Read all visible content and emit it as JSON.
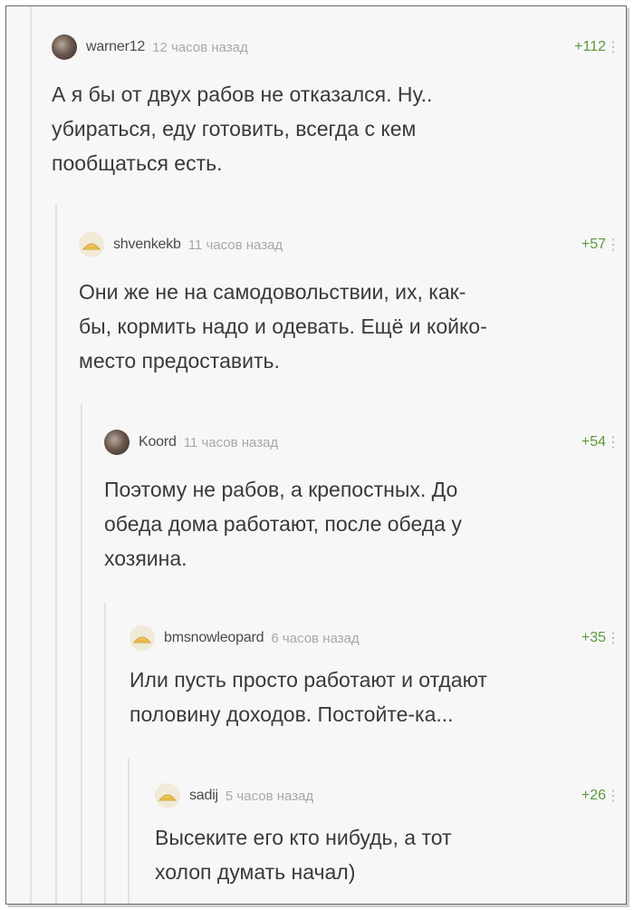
{
  "comments": [
    {
      "author": "warner12",
      "time": "12 часов назад",
      "rating": "+112",
      "avatar": "user-photo-avatar",
      "lines": [
        "А я бы от двух рабов не отказался. Ну..",
        "убираться, еду готовить, всегда с кем",
        "пообщаться есть."
      ]
    },
    {
      "author": "shvenkekb",
      "time": "11 часов назад",
      "rating": "+57",
      "avatar": "default-avatar",
      "lines": [
        "Они же не на самодовольствии, их, как-",
        "бы, кормить надо и одевать. Ещё и койко-",
        "место предоставить."
      ]
    },
    {
      "author": "Koord",
      "time": "11 часов назад",
      "rating": "+54",
      "avatar": "user-photo-avatar",
      "lines": [
        "Поэтому не рабов, а крепостных. До",
        "обеда дома работают, после обеда у",
        "хозяина."
      ]
    },
    {
      "author": "bmsnowleopard",
      "time": "6 часов назад",
      "rating": "+35",
      "avatar": "default-avatar",
      "lines": [
        "Или пусть просто работают и отдают",
        "половину доходов. Постойте-ка..."
      ]
    },
    {
      "author": "sadij",
      "time": "5 часов назад",
      "rating": "+26",
      "avatar": "default-avatar",
      "lines": [
        "Высеките его кто нибудь, а тот",
        "холоп думать начал)"
      ]
    }
  ],
  "more_icon": "⋮"
}
